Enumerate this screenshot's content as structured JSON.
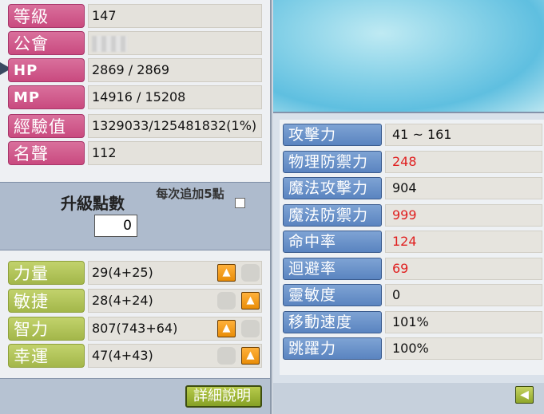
{
  "basic_stats": [
    {
      "label": "等級",
      "value": "147"
    },
    {
      "label": "公會",
      "value": ""
    },
    {
      "label": "HP",
      "value": "2869 / 2869"
    },
    {
      "label": "MP",
      "value": "14916 / 15208"
    },
    {
      "label": "經驗值",
      "value": "1329033/125481832(1%)"
    },
    {
      "label": "名聲",
      "value": "112"
    }
  ],
  "ap": {
    "title": "升級點數",
    "value": "0",
    "per5_label": "每次追加5點"
  },
  "primary_stats": [
    {
      "label": "力量",
      "value": "29(4+25)"
    },
    {
      "label": "敏捷",
      "value": "28(4+24)"
    },
    {
      "label": "智力",
      "value": "807(743+64)"
    },
    {
      "label": "幸運",
      "value": "47(4+43)"
    }
  ],
  "detail_button": "詳細說明",
  "secondary_stats": [
    {
      "label": "攻擊力",
      "value": "41 ~ 161",
      "color": "#111111"
    },
    {
      "label": "物理防禦力",
      "value": "248",
      "color": "#e02020"
    },
    {
      "label": "魔法攻擊力",
      "value": "904",
      "color": "#111111"
    },
    {
      "label": "魔法防禦力",
      "value": "999",
      "color": "#e02020"
    },
    {
      "label": "命中率",
      "value": "124",
      "color": "#e02020"
    },
    {
      "label": "迴避率",
      "value": "69",
      "color": "#e02020"
    },
    {
      "label": "靈敏度",
      "value": "0",
      "color": "#111111"
    },
    {
      "label": "移動速度",
      "value": "101%",
      "color": "#111111"
    },
    {
      "label": "跳躍力",
      "value": "100%",
      "color": "#111111"
    }
  ],
  "icons": {
    "up": "arrow-up-icon",
    "collapse": "arrow-left-icon"
  }
}
